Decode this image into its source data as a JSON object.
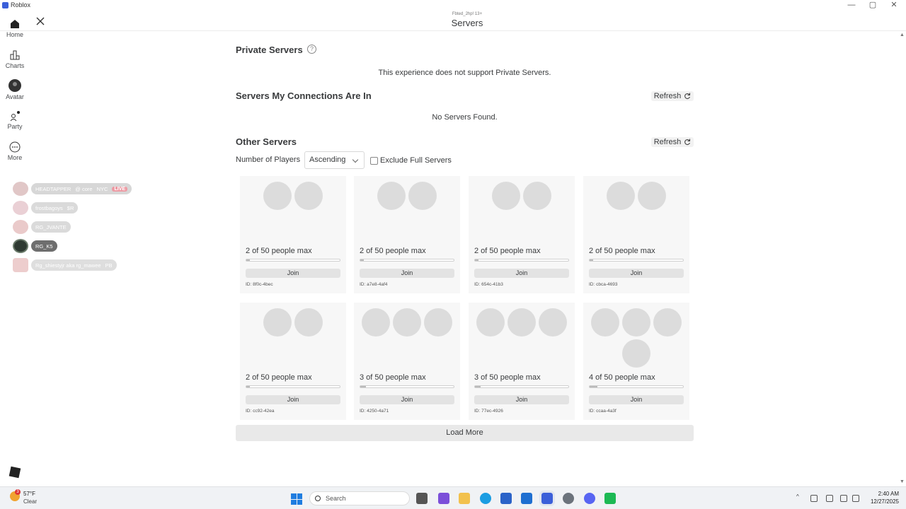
{
  "window": {
    "title": "Roblox",
    "minimize": "—",
    "maximize": "▢",
    "close": "✕"
  },
  "nav": [
    {
      "label": "Home"
    },
    {
      "label": "Charts"
    },
    {
      "label": "Avatar"
    },
    {
      "label": "Party"
    },
    {
      "label": "More"
    }
  ],
  "header": {
    "subtitle": "Fbted_2hp! 13+",
    "title": "Servers"
  },
  "friends": [
    {
      "name": "HEADTAPPER",
      "detail": "@ core",
      "extra": "NYC",
      "badge": "LIVE"
    },
    {
      "name": "frostbagoys",
      "detail": "",
      "extra": "$R",
      "badge": ""
    },
    {
      "name": "RG_JVANTE",
      "detail": "",
      "extra": "",
      "badge": ""
    },
    {
      "name": "RG_K5",
      "detail": "",
      "extra": "",
      "badge": ""
    },
    {
      "name": "Rg_shiestyjr aka rg_mawee",
      "detail": "",
      "extra": "PB",
      "badge": ""
    }
  ],
  "private": {
    "title": "Private Servers",
    "help": "?",
    "msg_prefix": "This experience does not support ",
    "msg_link": "Private Servers",
    "msg_suffix": "."
  },
  "connections": {
    "title": "Servers My Connections Are In",
    "refresh": "Refresh",
    "empty": "No Servers Found."
  },
  "other": {
    "title": "Other Servers",
    "refresh": "Refresh",
    "sort_label": "Number of Players",
    "sort_value": "Ascending",
    "exclude_label": "Exclude Full Servers",
    "join_label": "Join",
    "load_more": "Load More",
    "servers": [
      {
        "caption": "2 of 50 people max",
        "players": 2,
        "max": 50,
        "id": "ID: 8f0c-4bec"
      },
      {
        "caption": "2 of 50 people max",
        "players": 2,
        "max": 50,
        "id": "ID: a7e8-4af4"
      },
      {
        "caption": "2 of 50 people max",
        "players": 2,
        "max": 50,
        "id": "ID: 654c-41b3"
      },
      {
        "caption": "2 of 50 people max",
        "players": 2,
        "max": 50,
        "id": "ID: cbca-4693"
      },
      {
        "caption": "2 of 50 people max",
        "players": 2,
        "max": 50,
        "id": "ID: cc92-42ea"
      },
      {
        "caption": "3 of 50 people max",
        "players": 3,
        "max": 50,
        "id": "ID: 4250-4a71"
      },
      {
        "caption": "3 of 50 people max",
        "players": 3,
        "max": 50,
        "id": "ID: 77ec-4926"
      },
      {
        "caption": "4 of 50 people max",
        "players": 4,
        "max": 50,
        "id": "ID: ccaa-4a3f"
      }
    ]
  },
  "taskbar": {
    "weather_temp": "57°F",
    "weather_desc": "Clear",
    "weather_badge": "3",
    "search_label": "Search",
    "time": "2:40 AM",
    "date": "12/27/2025"
  }
}
